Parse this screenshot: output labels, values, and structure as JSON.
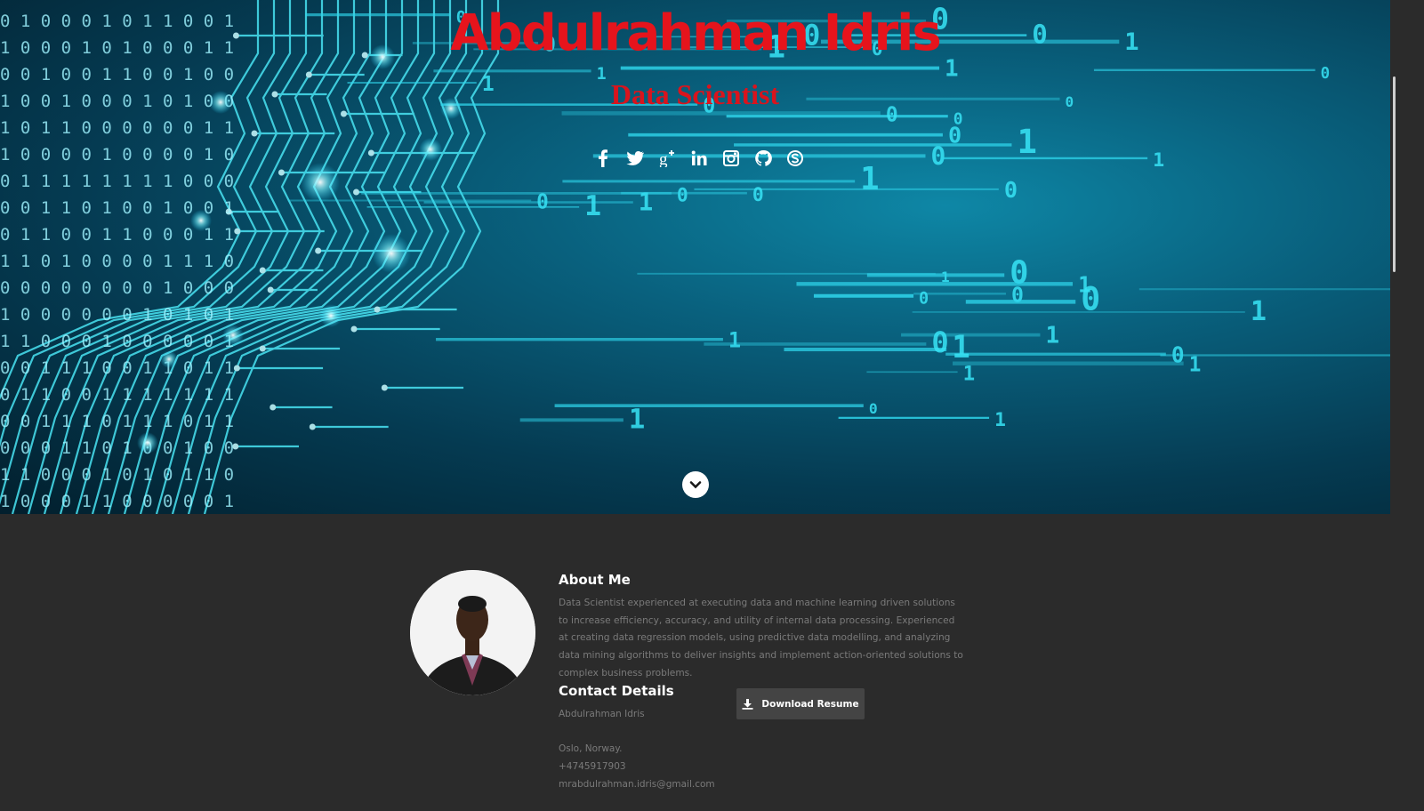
{
  "hero": {
    "name": "Abdulrahman Idris",
    "title": "Data Scientist",
    "social_icons": [
      "facebook-icon",
      "twitter-icon",
      "google-plus-icon",
      "linkedin-icon",
      "instagram-icon",
      "github-icon",
      "skype-icon"
    ],
    "scroll_icon": "chevron-down-icon",
    "accent_color": "#e6141c",
    "background_color": "#0a5a78"
  },
  "about": {
    "heading": "About Me",
    "description": "Data Scientist experienced at executing data and machine learning driven solutions to increase efficiency, accuracy, and utility of internal data processing. Experienced at creating data regression models, using predictive data modelling, and analyzing data mining algorithms to deliver insights and implement action-oriented solutions to complex business problems."
  },
  "contact": {
    "heading": "Contact Details",
    "name": "Abdulrahman Idris",
    "location": "Oslo, Norway.",
    "phone": "+4745917903",
    "email": "mrabdulrahman.idris@gmail.com"
  },
  "download": {
    "label": "Download Resume",
    "icon": "download-icon"
  }
}
